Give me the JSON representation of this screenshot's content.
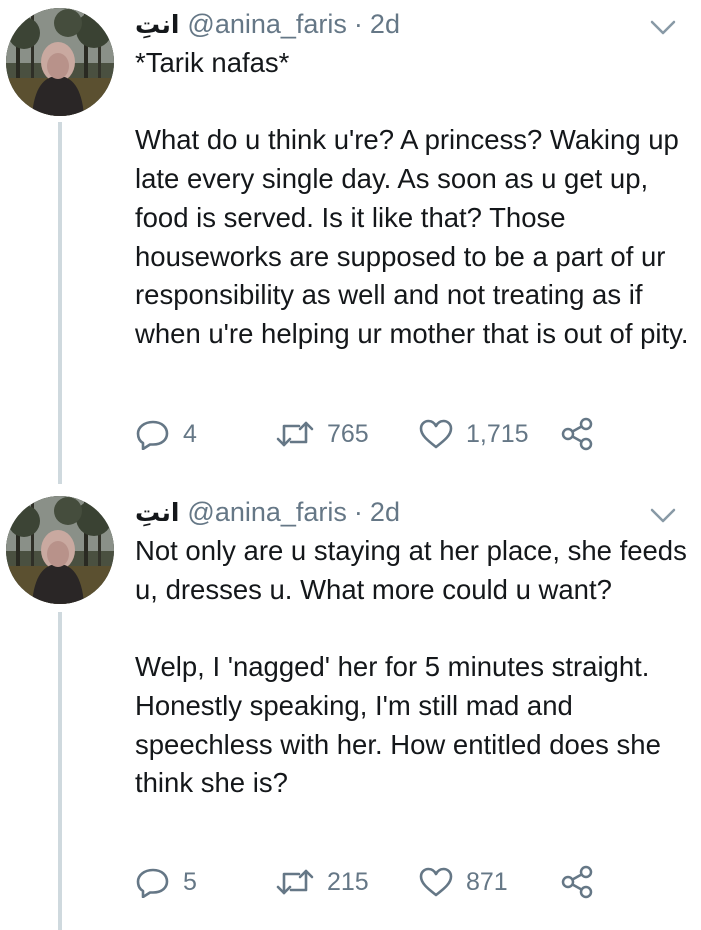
{
  "icon_color": "#657786",
  "thread_line_color": "#cfd9de",
  "tweets": [
    {
      "display_name": "انتِ",
      "handle": "@anina_faris",
      "separator": "·",
      "time": "2d",
      "text": "*Tarik nafas*\n\nWhat do u think u're? A princess? Waking up late every single day. As soon as u get up, food is served. Is it like that? Those houseworks are supposed to be a part of ur responsibility as well and not treating as if when u're helping ur mother that is out of pity.",
      "replies": "4",
      "retweets": "765",
      "likes": "1,715",
      "icons": [
        "avatar",
        "chevron-down-icon",
        "reply-icon",
        "retweet-icon",
        "like-icon",
        "share-icon"
      ]
    },
    {
      "display_name": "انتِ",
      "handle": "@anina_faris",
      "separator": "·",
      "time": "2d",
      "text": "Not only are u staying at her place, she feeds u, dresses u. What more could u want?\n\nWelp, I 'nagged' her for 5 minutes straight. Honestly speaking, I'm still mad and speechless with her. How entitled does she think she is?",
      "replies": "5",
      "retweets": "215",
      "likes": "871",
      "icons": [
        "avatar",
        "chevron-down-icon",
        "reply-icon",
        "retweet-icon",
        "like-icon",
        "share-icon"
      ]
    }
  ]
}
